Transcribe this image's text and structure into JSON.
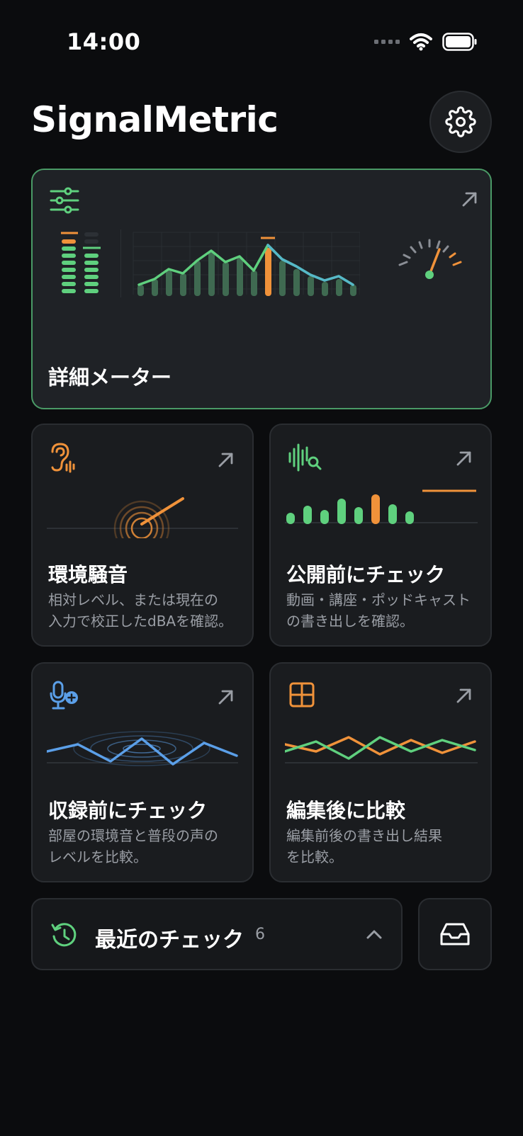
{
  "status_bar": {
    "time": "14:00"
  },
  "header": {
    "app_title": "SignalMetric"
  },
  "hero_card": {
    "title": "詳細メーター"
  },
  "cards": [
    {
      "title": "環境騒音",
      "desc_line1": "相対レベル、または現在の",
      "desc_line2": "入力で校正したdBAを確認。"
    },
    {
      "title": "公開前にチェック",
      "desc_line1": "動画・講座・ポッドキャスト",
      "desc_line2": "の書き出しを確認。"
    },
    {
      "title": "収録前にチェック",
      "desc_line1": "部屋の環境音と普段の声の",
      "desc_line2": "レベルを比較。"
    },
    {
      "title": "編集後に比較",
      "desc_line1": "編集前後の書き出し結果",
      "desc_line2": "を比較。"
    }
  ],
  "recent": {
    "label": "最近のチェック",
    "count": "6"
  },
  "colors": {
    "green": "#5fd07e",
    "orange": "#f0923a",
    "blue": "#5b9fe8",
    "teal": "#56b8c9"
  },
  "icons": {
    "settings": "gear-icon",
    "hero": "sliders-icon",
    "env": "ear-icon",
    "pub": "waveform-search-icon",
    "pre": "microphone-add-icon",
    "post": "grid-icon",
    "recent": "history-icon",
    "inbox": "inbox-icon",
    "expand": "chevron-up-icon"
  }
}
